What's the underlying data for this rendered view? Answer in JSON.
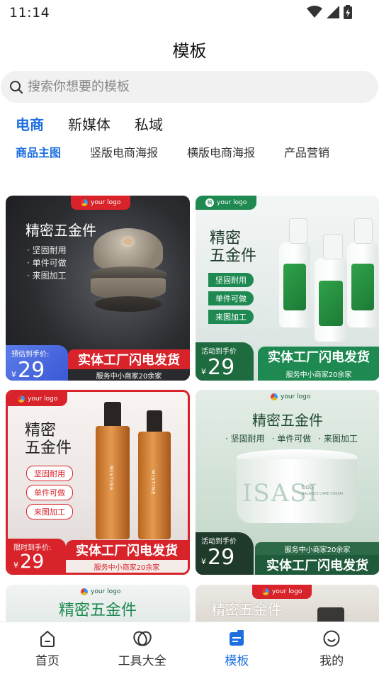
{
  "status_bar": {
    "time": "11:14"
  },
  "header": {
    "title": "模板"
  },
  "search": {
    "placeholder": "搜索你想要的模板"
  },
  "main_tabs": [
    {
      "label": "电商",
      "active": true
    },
    {
      "label": "新媒体",
      "active": false
    },
    {
      "label": "私域",
      "active": false
    }
  ],
  "sub_tabs": [
    {
      "label": "商品主图",
      "active": true
    },
    {
      "label": "竖版电商海报",
      "active": false
    },
    {
      "label": "横版电商海报",
      "active": false
    },
    {
      "label": "产品营销",
      "active": false
    }
  ],
  "cards": [
    {
      "logo": "your logo",
      "headline": "精密五金件",
      "bullets": [
        "· 坚固耐用",
        "· 单件可做",
        "· 来图加工"
      ],
      "price_label": "预估到手价:",
      "currency": "¥",
      "price": "29",
      "banner": "实体工厂闪电发货",
      "subline": "服务中小商家20余家"
    },
    {
      "logo": "your logo",
      "logo_mark": "稿",
      "headline_1": "精密",
      "headline_2": "五金件",
      "bullets": [
        "坚固耐用",
        "单件可做",
        "来图加工"
      ],
      "price_label": "活动到手价",
      "currency": "¥",
      "price": "29",
      "banner": "实体工厂闪电发货",
      "subline": "服务中小商家20余家"
    },
    {
      "logo": "your logo",
      "headline_1": "精密",
      "headline_2": "五金件",
      "bullets": [
        "坚固耐用",
        "单件可做",
        "来图加工"
      ],
      "bottle_text": "MISTINE",
      "price_label": "限时到手价:",
      "currency": "¥",
      "price": "29",
      "banner": "实体工厂闪电发货",
      "subline": "服务中小商家20余家"
    },
    {
      "logo": "your logo",
      "headline": "精密五金件",
      "bullets": [
        "· 坚固耐用",
        "· 单件可做",
        "· 来图加工"
      ],
      "jar_text": "ISASI",
      "jar_sub_1": "DOG",
      "jar_sub_2": "BALANCE CARE CREAM",
      "price_label": "活动到手价",
      "currency": "¥",
      "price": "29",
      "subline": "服务中小商家20余家",
      "banner": "实体工厂闪电发货"
    },
    {
      "logo": "your logo",
      "headline": "精密五金件"
    },
    {
      "logo": "your logo",
      "headline": "精密五金件"
    }
  ],
  "bottom_nav": [
    {
      "label": "首页",
      "icon": "home-icon",
      "active": false
    },
    {
      "label": "工具大全",
      "icon": "tools-icon",
      "active": false
    },
    {
      "label": "模板",
      "icon": "template-icon",
      "active": true
    },
    {
      "label": "我的",
      "icon": "profile-icon",
      "active": false
    }
  ],
  "colors": {
    "accent": "#1d6fe0",
    "red": "#d8232a",
    "green": "#1e8a52",
    "dark_green": "#1f5a3a"
  }
}
